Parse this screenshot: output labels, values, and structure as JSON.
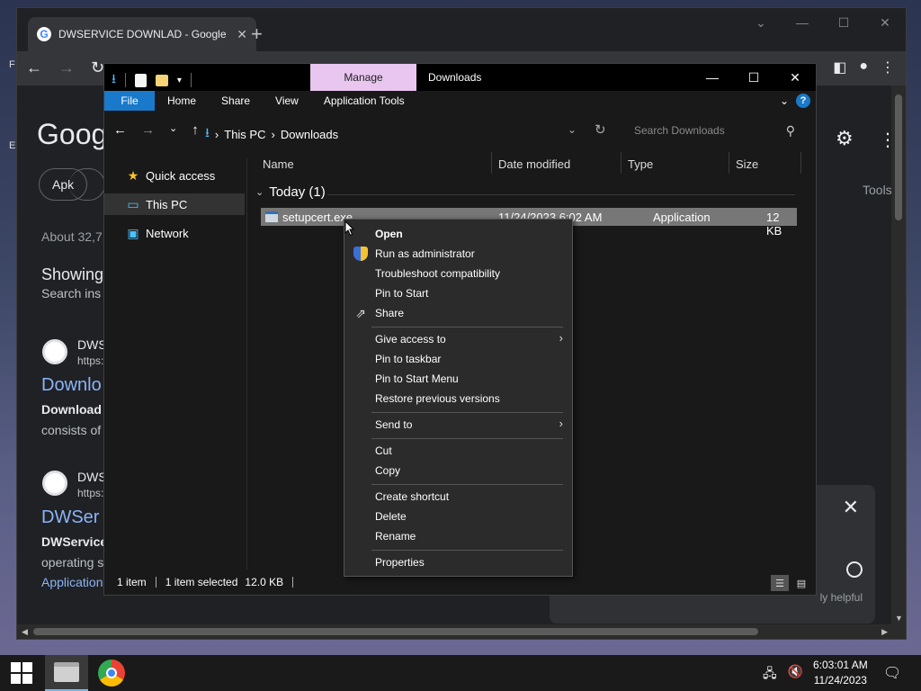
{
  "chrome": {
    "tab_title": "DWSERVICE DOWNLAD - Google",
    "google_logo": "Goog",
    "chip_1": "Apk",
    "tools_label": "Tools",
    "about": "About 32,7",
    "showing": "Showing",
    "search_instead": "Search ins",
    "results": [
      {
        "site": "DWS",
        "url": "https:",
        "title": "Downlo",
        "snippet_bold": "Download",
        "snippet_rest": "consists of"
      },
      {
        "site": "DWS",
        "url": "https:",
        "title": "DWSer",
        "snippet_bold": "DWService",
        "snippet_rest": "operating s",
        "link": "Application"
      }
    ],
    "helpful_text": "ly helpful"
  },
  "explorer": {
    "manage_tab": "Manage",
    "window_title": "Downloads",
    "ribbon_tabs": [
      "File",
      "Home",
      "Share",
      "View",
      "Application Tools"
    ],
    "path": [
      "This PC",
      "Downloads"
    ],
    "search_placeholder": "Search Downloads",
    "nav": [
      "Quick access",
      "This PC",
      "Network"
    ],
    "columns": [
      "Name",
      "Date modified",
      "Type",
      "Size"
    ],
    "group_label": "Today (1)",
    "file": {
      "name": "setupcert.exe",
      "date": "11/24/2023 6:02 AM",
      "type": "Application",
      "size": "12 KB"
    },
    "status": {
      "count": "1 item",
      "selected": "1 item selected",
      "size": "12.0 KB"
    }
  },
  "context_menu": {
    "items": [
      "Open",
      "Run as administrator",
      "Troubleshoot compatibility",
      "Pin to Start",
      "Share",
      "Give access to",
      "Pin to taskbar",
      "Pin to Start Menu",
      "Restore previous versions",
      "Send to",
      "Cut",
      "Copy",
      "Create shortcut",
      "Delete",
      "Rename",
      "Properties"
    ]
  },
  "taskbar": {
    "time": "6:03:01 AM",
    "date": "11/24/2023"
  },
  "desktop": {
    "edge_text_1": "F",
    "edge_text_2": "E"
  }
}
